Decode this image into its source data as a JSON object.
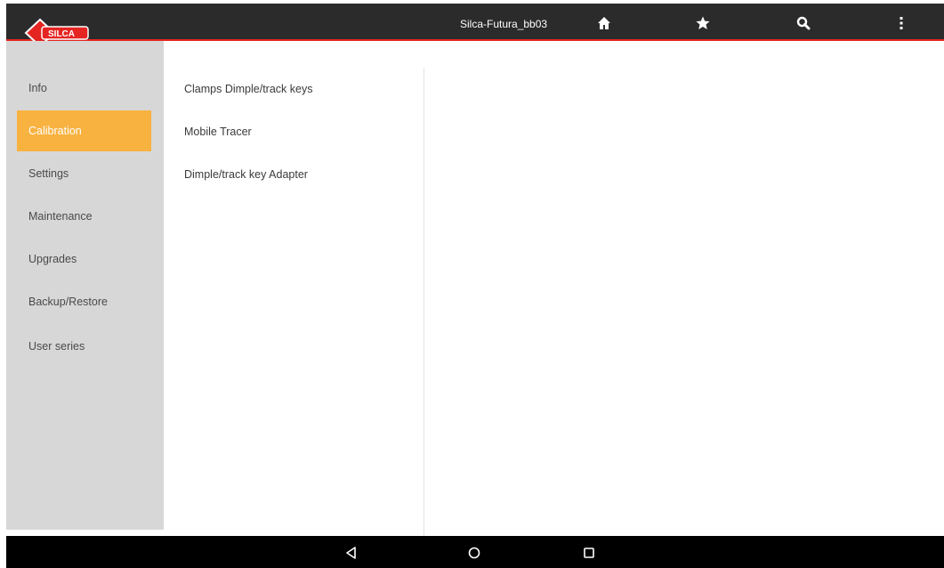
{
  "app": {
    "title": "Silca-Futura_bb03",
    "logo_text": "SILCA"
  },
  "toolbar": {
    "icons": [
      "home-icon",
      "star-icon",
      "search-icon",
      "more-vertical-icon"
    ]
  },
  "sidebar": {
    "items": [
      {
        "label": "Info",
        "active": false
      },
      {
        "label": "Calibration",
        "active": true
      },
      {
        "label": "Settings",
        "active": false
      },
      {
        "label": "Maintenance",
        "active": false
      },
      {
        "label": "Upgrades",
        "active": false
      },
      {
        "label": "Backup/Restore",
        "active": false
      },
      {
        "label": "User series",
        "active": false
      }
    ]
  },
  "calibration": {
    "items": [
      {
        "label": "Clamps Dimple/track keys"
      },
      {
        "label": "Mobile Tracer"
      },
      {
        "label": "Dimple/track key Adapter"
      }
    ]
  },
  "navigation": {
    "buttons": [
      "back-icon",
      "home-circle-icon",
      "recents-icon"
    ]
  },
  "colors": {
    "topbar": "#2b2b2b",
    "accent_red": "#e52521",
    "sidebar_bg": "#d7d7d7",
    "active_item": "#f8b240",
    "navbar": "#000000"
  }
}
